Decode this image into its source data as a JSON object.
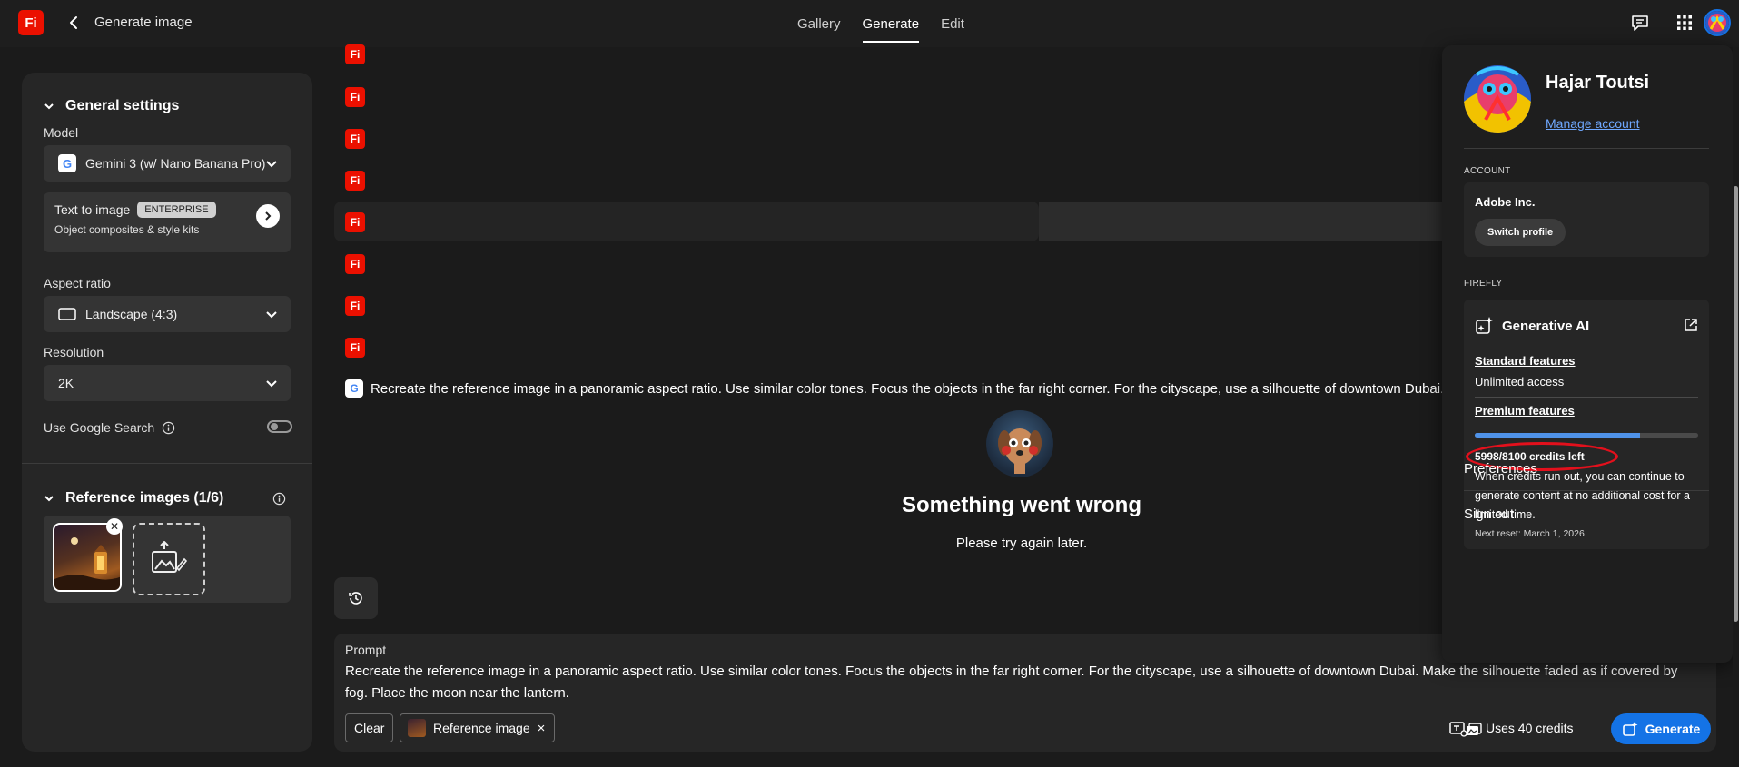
{
  "header": {
    "logo_text": "Fi",
    "page_title": "Generate image",
    "tabs": [
      {
        "label": "Gallery",
        "active": false
      },
      {
        "label": "Generate",
        "active": true
      },
      {
        "label": "Edit",
        "active": false
      }
    ],
    "icons": [
      "back-chevron-icon",
      "feedback-icon",
      "app-grid-icon",
      "user-avatar"
    ]
  },
  "sidebar": {
    "general_title": "General settings",
    "model_label": "Model",
    "model_value": "Gemini 3 (w/ Nano Banana Pro)",
    "model_logo": "G",
    "t2i_title": "Text to image",
    "t2i_badge": "ENTERPRISE",
    "t2i_sub": "Object composites & style kits",
    "aspect_label": "Aspect ratio",
    "aspect_value": "Landscape (4:3)",
    "resolution_label": "Resolution",
    "resolution_value": "2K",
    "google_search_label": "Use Google Search",
    "google_search_on": false,
    "reference_title": "Reference images (1/6)"
  },
  "feed": {
    "fi_label": "Fi",
    "google_label": "G",
    "prompt_echo": "Recreate the reference image in a panoramic aspect ratio. Use similar color tones. Focus the objects in the far right corner. For the cityscape, use a silhouette of downtown Dubai. Make",
    "error_title": "Something went wrong",
    "error_sub": "Please try again later."
  },
  "prompt_box": {
    "label": "Prompt",
    "text": " Recreate the reference image in a panoramic aspect ratio. Use similar color tones. Focus the objects in the far right corner. For the cityscape, use a silhouette of downtown Dubai. Make the silhouette faded as if covered by fog. Place the moon near the lantern.",
    "clear_label": "Clear",
    "reference_chip": "Reference image",
    "chip_close": "×",
    "credits_text": "Uses 40 credits",
    "generate_label": "Generate"
  },
  "account_popover": {
    "name": "Hajar Toutsi",
    "manage_link": "Manage account",
    "account_caption": "ACCOUNT",
    "org_name": "Adobe Inc.",
    "switch_profile": "Switch profile",
    "firefly_caption": "FIREFLY",
    "gen_ai_title": "Generative AI",
    "standard_link": "Standard features",
    "standard_value": "Unlimited access",
    "premium_link": "Premium features",
    "credits_left": "5998/8100 credits left",
    "credits_used_fraction": 0.7405,
    "note": "When credits run out, you can continue to generate content at no additional cost for a limited time.",
    "reset": "Next reset: March 1, 2026",
    "preferences": "Preferences",
    "sign_out": "Sign out"
  },
  "colors": {
    "brand_red": "#eb1000",
    "accent_blue": "#1473e6",
    "annotation_red": "#e3101c"
  }
}
